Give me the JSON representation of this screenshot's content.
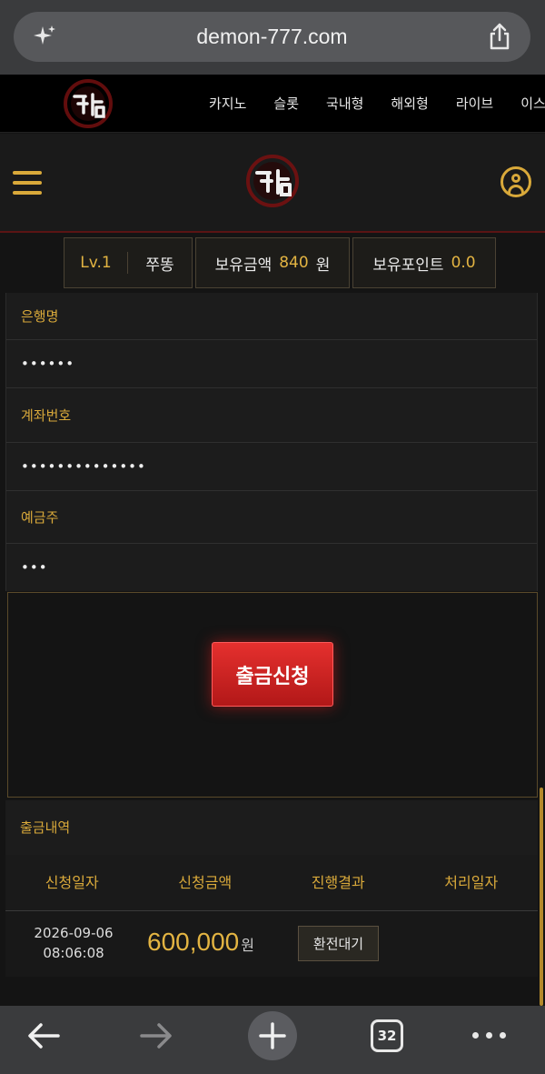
{
  "browser": {
    "url": "demon-777.com",
    "tab_count": "32"
  },
  "top_nav": {
    "items": [
      "카지노",
      "슬롯",
      "국내형",
      "해외형",
      "라이브",
      "이스"
    ]
  },
  "user_info": {
    "level": "Lv.1",
    "nickname": "쭈똥",
    "balance_label": "보유금액",
    "balance_value": "840",
    "balance_unit": "원",
    "points_label": "보유포인트",
    "points_value": "0.0"
  },
  "form": {
    "bank_label": "은행명",
    "bank_value": "••••••",
    "account_label": "계좌번호",
    "account_value": "••••••••••••••",
    "holder_label": "예금주",
    "holder_value": "•••"
  },
  "action": {
    "withdraw_button": "출금신청"
  },
  "history": {
    "title": "출금내역",
    "columns": [
      "신청일자",
      "신청금액",
      "진행결과",
      "처리일자"
    ],
    "rows": [
      {
        "date_line1": "2026-09-06",
        "date_line2": "08:06:08",
        "amount": "600,000",
        "amount_unit": "원",
        "status": "환전대기",
        "processed_date": ""
      }
    ]
  },
  "colors": {
    "accent_gold": "#d9a93a",
    "button_red": "#d42424",
    "background": "#141414"
  },
  "icons": {
    "sparkle": "sparkle-icon",
    "share": "share-icon",
    "menu": "hamburger-menu-icon",
    "user": "user-account-icon",
    "back": "back-arrow-icon",
    "forward": "forward-arrow-icon",
    "new_tab": "plus-icon",
    "more": "more-dots-icon"
  }
}
